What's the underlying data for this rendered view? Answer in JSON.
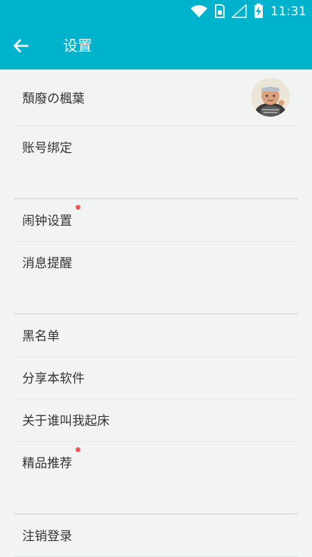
{
  "status_bar": {
    "time": "11:31",
    "icons": [
      "wifi-icon",
      "sim-icon",
      "signal-icon",
      "battery-charging-icon"
    ]
  },
  "app_bar": {
    "title": "设置",
    "back_icon": "arrow-left-icon"
  },
  "profile": {
    "name": "頽廢の楓葉"
  },
  "groups": [
    {
      "items": [
        {
          "label": "账号绑定",
          "dot": false
        }
      ]
    },
    {
      "items": [
        {
          "label": "闹钟设置",
          "dot": true
        },
        {
          "label": "消息提醒",
          "dot": false
        }
      ]
    },
    {
      "items": [
        {
          "label": "黑名单",
          "dot": false
        },
        {
          "label": "分享本软件",
          "dot": false
        },
        {
          "label": "关于谁叫我起床",
          "dot": false
        },
        {
          "label": "精品推荐",
          "dot": true
        }
      ]
    },
    {
      "items": [
        {
          "label": "注销登录",
          "dot": false
        }
      ]
    }
  ],
  "colors": {
    "accent": "#00b3cc",
    "background": "#f2f4f4",
    "badge": "#ea5a57"
  }
}
